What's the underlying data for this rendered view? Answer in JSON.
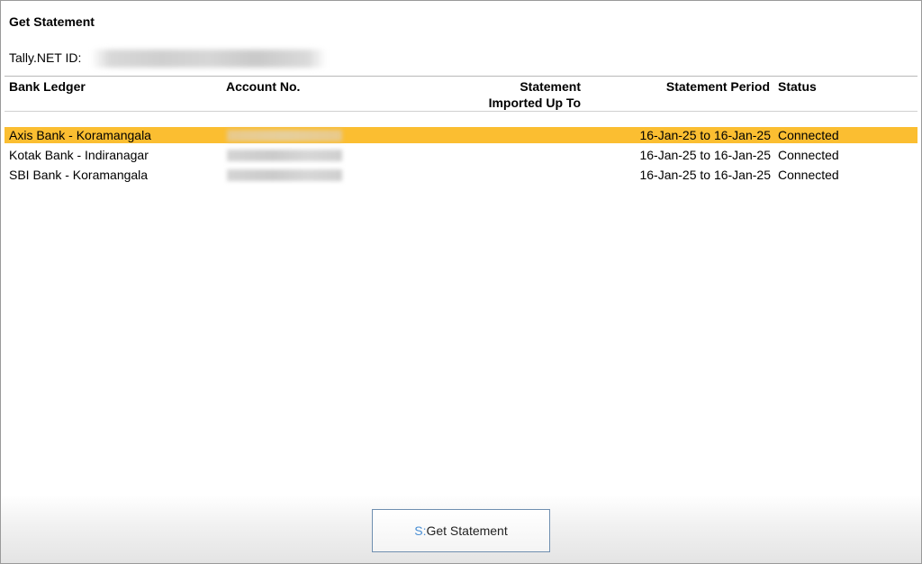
{
  "window": {
    "title": "Get Statement",
    "tally_net_id_label": "Tally.NET ID:"
  },
  "table": {
    "headers": {
      "bank_ledger": "Bank Ledger",
      "account_no": "Account No.",
      "statement_imported_line1": "Statement",
      "statement_imported_line2": "Imported Up To",
      "statement_period": "Statement Period",
      "status": "Status"
    },
    "rows": [
      {
        "ledger": "Axis Bank - Koramangala",
        "period": "16-Jan-25 to 16-Jan-25",
        "status": "Connected",
        "selected": true
      },
      {
        "ledger": "Kotak Bank - Indiranagar",
        "period": "16-Jan-25 to 16-Jan-25",
        "status": "Connected",
        "selected": false
      },
      {
        "ledger": "SBI Bank - Koramangala",
        "period": "16-Jan-25 to 16-Jan-25",
        "status": "Connected",
        "selected": false
      }
    ]
  },
  "footer": {
    "button_key": "S:",
    "button_label": "Get Statement"
  },
  "colors": {
    "selection": "#fbbe31",
    "shortcut_key": "#4a8fd4",
    "button_border": "#6f8fb0"
  }
}
